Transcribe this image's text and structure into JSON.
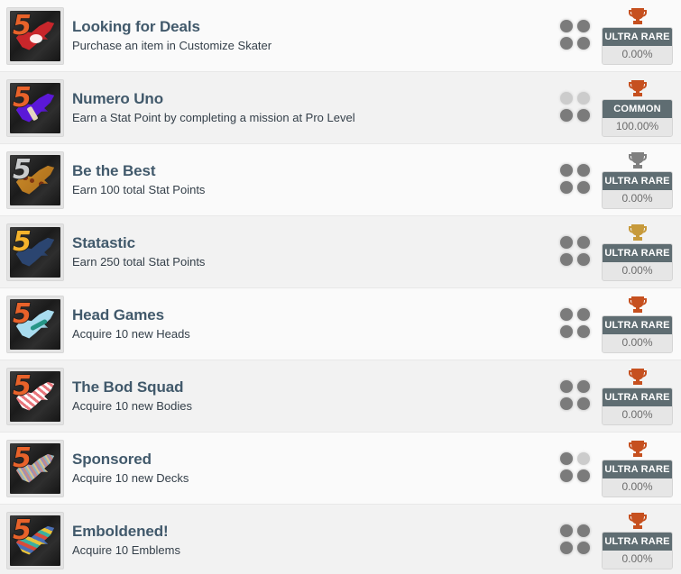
{
  "list": {
    "name": "trophy-list",
    "rows": [
      {
        "title": "Looking for Deals",
        "description": "Purchase an item in Customize Skater",
        "icon_name": "trophy-thumb-looking-for-deals",
        "icon_wing_color": "#c8262b",
        "icon_five_color": "#e8622a",
        "icon_mark": "dots",
        "dots": [
          "on",
          "on",
          "on",
          "on"
        ],
        "trophy_color": "#c6501f",
        "rarity": "ULTRA RARE",
        "percent": "0.00%"
      },
      {
        "title": "Numero Uno",
        "description": "Earn a Stat Point by completing a mission at Pro Level",
        "icon_name": "trophy-thumb-numero-uno",
        "icon_wing_color": "#5b18d8",
        "icon_five_color": "#e8622a",
        "icon_mark": "one",
        "dots": [
          "off",
          "off",
          "on",
          "on"
        ],
        "trophy_color": "#c6501f",
        "rarity": "COMMON",
        "percent": "100.00%"
      },
      {
        "title": "Be the Best",
        "description": "Earn 100 total Stat Points",
        "icon_name": "trophy-thumb-be-the-best",
        "icon_wing_color": "#c98a2a",
        "icon_five_color": "#c9cbcc",
        "icon_mark": "stars",
        "dots": [
          "on",
          "on",
          "on",
          "on"
        ],
        "trophy_color": "#808080",
        "rarity": "ULTRA RARE",
        "percent": "0.00%"
      },
      {
        "title": "Statastic",
        "description": "Earn 250 total Stat Points",
        "icon_name": "trophy-thumb-statastic",
        "icon_wing_color": "#2b4570",
        "icon_five_color": "#f5b32c",
        "icon_mark": "none",
        "dots": [
          "on",
          "on",
          "on",
          "on"
        ],
        "trophy_color": "#c79a3b",
        "rarity": "ULTRA RARE",
        "percent": "0.00%"
      },
      {
        "title": "Head Games",
        "description": "Acquire 10 new Heads",
        "icon_name": "trophy-thumb-head-games",
        "icon_wing_color": "#a8dcef",
        "icon_five_color": "#e8622a",
        "icon_mark": "teal",
        "dots": [
          "on",
          "on",
          "on",
          "on"
        ],
        "trophy_color": "#c6501f",
        "rarity": "ULTRA RARE",
        "percent": "0.00%"
      },
      {
        "title": "The Bod Squad",
        "description": "Acquire 10 new Bodies",
        "icon_name": "trophy-thumb-the-bod-squad",
        "icon_wing_color": "#e8767c",
        "icon_five_color": "#e8622a",
        "icon_mark": "check",
        "dots": [
          "on",
          "on",
          "on",
          "on"
        ],
        "trophy_color": "#c6501f",
        "rarity": "ULTRA RARE",
        "percent": "0.00%"
      },
      {
        "title": "Sponsored",
        "description": "Acquire 10 new Decks",
        "icon_name": "trophy-thumb-sponsored",
        "icon_wing_color": "#b9a9a2",
        "icon_five_color": "#e8622a",
        "icon_mark": "stripes",
        "dots": [
          "on",
          "off",
          "on",
          "on"
        ],
        "trophy_color": "#c6501f",
        "rarity": "ULTRA RARE",
        "percent": "0.00%"
      },
      {
        "title": "Emboldened!",
        "description": "Acquire 10 Emblems",
        "icon_name": "trophy-thumb-emboldened",
        "icon_wing_color": "#6f7b82",
        "icon_five_color": "#e8622a",
        "icon_mark": "confetti",
        "dots": [
          "on",
          "on",
          "on",
          "on"
        ],
        "trophy_color": "#c6501f",
        "rarity": "ULTRA RARE",
        "percent": "0.00%"
      }
    ]
  },
  "glyphs": {
    "five": "5",
    "trophy": "trophy-icon"
  }
}
